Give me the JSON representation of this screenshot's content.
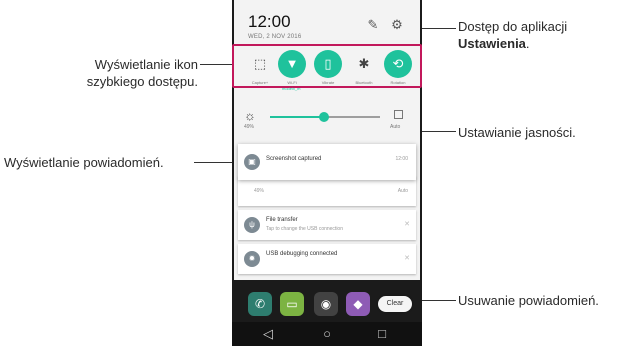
{
  "callouts": {
    "settings_line1": "Dostęp do aplikacji",
    "settings_line2_bold": "Ustawienia",
    "settings_line2_end": ".",
    "quick_line1": "Wyświetlanie ikon",
    "quick_line2": "szybkiego dostępu.",
    "brightness": "Ustawianie jasności.",
    "notifications": "Wyświetlanie powiadomień.",
    "clear": "Usuwanie powiadomień."
  },
  "phone": {
    "time": "12:00",
    "date": "WED, 2 NOV 2016",
    "header_icons": [
      "pencil-icon",
      "gear-icon"
    ],
    "quick_settings": [
      {
        "icon": "capture-plus-icon",
        "glyph": "⬚",
        "label": "Capture+",
        "on": false
      },
      {
        "icon": "wifi-icon",
        "glyph": "▼",
        "label": "Wi-Fi",
        "on": true
      },
      {
        "icon": "vibrate-icon",
        "glyph": "▯",
        "label": "Vibrate",
        "on": true
      },
      {
        "icon": "bluetooth-icon",
        "glyph": "✱",
        "label": "Bluetooth",
        "on": false
      },
      {
        "icon": "rotation-icon",
        "glyph": "⟲",
        "label": "Rotation",
        "on": true
      }
    ],
    "wifi_network": "modelx_m",
    "brightness": {
      "percent_label": "49%",
      "level": 0.49,
      "auto_label": "Auto"
    },
    "notifications": [
      {
        "title": "Screenshot captured",
        "subtitle": "",
        "time": "12:00",
        "icon": "image-icon",
        "glyph": "▣"
      },
      {
        "title": "",
        "subtitle": "49%",
        "time": "Auto",
        "icon": "",
        "glyph": ""
      },
      {
        "title": "File transfer",
        "subtitle": "Tap to change the USB connection",
        "time": "",
        "icon": "usb-icon",
        "glyph": "ψ"
      },
      {
        "title": "USB debugging connected",
        "subtitle": "",
        "time": "",
        "icon": "bug-icon",
        "glyph": "✹"
      }
    ],
    "dock_apps": [
      "phone-app-icon",
      "messages-app-icon",
      "camera-app-icon",
      "gallery-app-icon"
    ],
    "clear_label": "Clear",
    "nav": {
      "back": "◁",
      "home": "○",
      "recents": "□"
    },
    "colors": {
      "accent": "#1fc29c",
      "highlight": "#c2185b"
    }
  }
}
